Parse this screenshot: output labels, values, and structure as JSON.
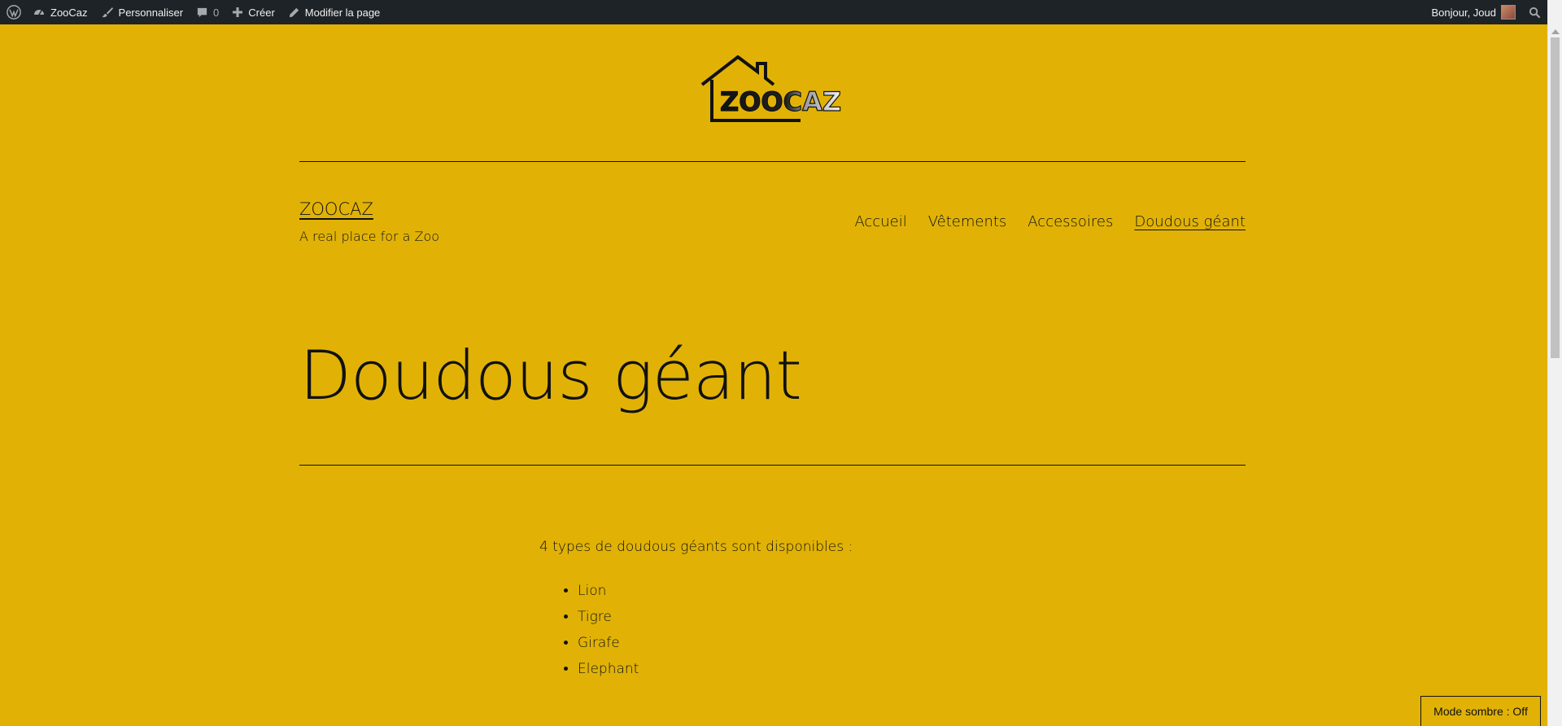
{
  "admin_bar": {
    "site_name": "ZooCaz",
    "customize": "Personnaliser",
    "comments_count": "0",
    "new": "Créer",
    "edit_page": "Modifier la page",
    "greeting": "Bonjour, Joud"
  },
  "logo": {
    "text": "ZOOCAZ"
  },
  "header": {
    "site_title": "ZOOCAZ",
    "tagline": "A real place for a Zoo",
    "nav": [
      {
        "label": "Accueil",
        "current": false
      },
      {
        "label": "Vêtements",
        "current": false
      },
      {
        "label": "Accessoires",
        "current": false
      },
      {
        "label": "Doudous géant",
        "current": true
      }
    ]
  },
  "page": {
    "title": "Doudous géant",
    "intro": "4 types de doudous géants sont disponibles :",
    "items": [
      "Lion",
      "Tigre",
      "Girafe",
      "Elephant"
    ]
  },
  "dark_mode": {
    "label": "Mode sombre : Off"
  },
  "colors": {
    "background": "#e1b205",
    "admin_bar": "#1d2327",
    "text": "#111111"
  }
}
